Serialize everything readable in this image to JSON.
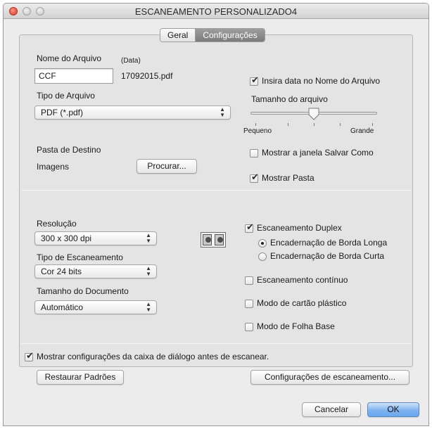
{
  "window": {
    "title": "ESCANEAMENTO PERSONALIZADO4"
  },
  "tabs": [
    {
      "label": "Geral",
      "active": false
    },
    {
      "label": "Configurações",
      "active": true
    }
  ],
  "file": {
    "name_label": "Nome do Arquivo",
    "date_hint": "(Data)",
    "name_value": "CCF",
    "preview": "17092015.pdf",
    "insert_date_label": "Insira data no Nome do Arquivo",
    "insert_date_checked": true,
    "type_label": "Tipo de Arquivo",
    "type_value": "PDF (*.pdf)",
    "size_label": "Tamanho do arquivo",
    "size_min_label": "Pequeno",
    "size_max_label": "Grande",
    "size_level": 0.5
  },
  "destination": {
    "label": "Pasta de Destino",
    "folder": "Imagens",
    "browse_button": "Procurar...",
    "show_save_as_label": "Mostrar a janela Salvar Como",
    "show_save_as_checked": false,
    "show_folder_label": "Mostrar Pasta",
    "show_folder_checked": true
  },
  "scan": {
    "resolution_label": "Resolução",
    "resolution_value": "300 x 300 dpi",
    "scan_type_label": "Tipo de Escaneamento",
    "scan_type_value": "Cor 24 bits",
    "doc_size_label": "Tamanho do Documento",
    "doc_size_value": "Automático",
    "duplex_label": "Escaneamento Duplex",
    "duplex_checked": true,
    "long_edge_label": "Encadernação de Borda Longa",
    "long_edge_selected": true,
    "short_edge_label": "Encadernação de Borda Curta",
    "continuous_label": "Escaneamento contínuo",
    "plastic_card_label": "Modo de cartão plástico",
    "carrier_sheet_label": "Modo de Folha Base"
  },
  "footer": {
    "show_dialog_label": "Mostrar configurações da caixa de diálogo antes de escanear.",
    "show_dialog_checked": true,
    "restore_button": "Restaurar Padrões",
    "scan_settings_button": "Configurações de escaneamento...",
    "cancel_button": "Cancelar",
    "ok_button": "OK"
  }
}
